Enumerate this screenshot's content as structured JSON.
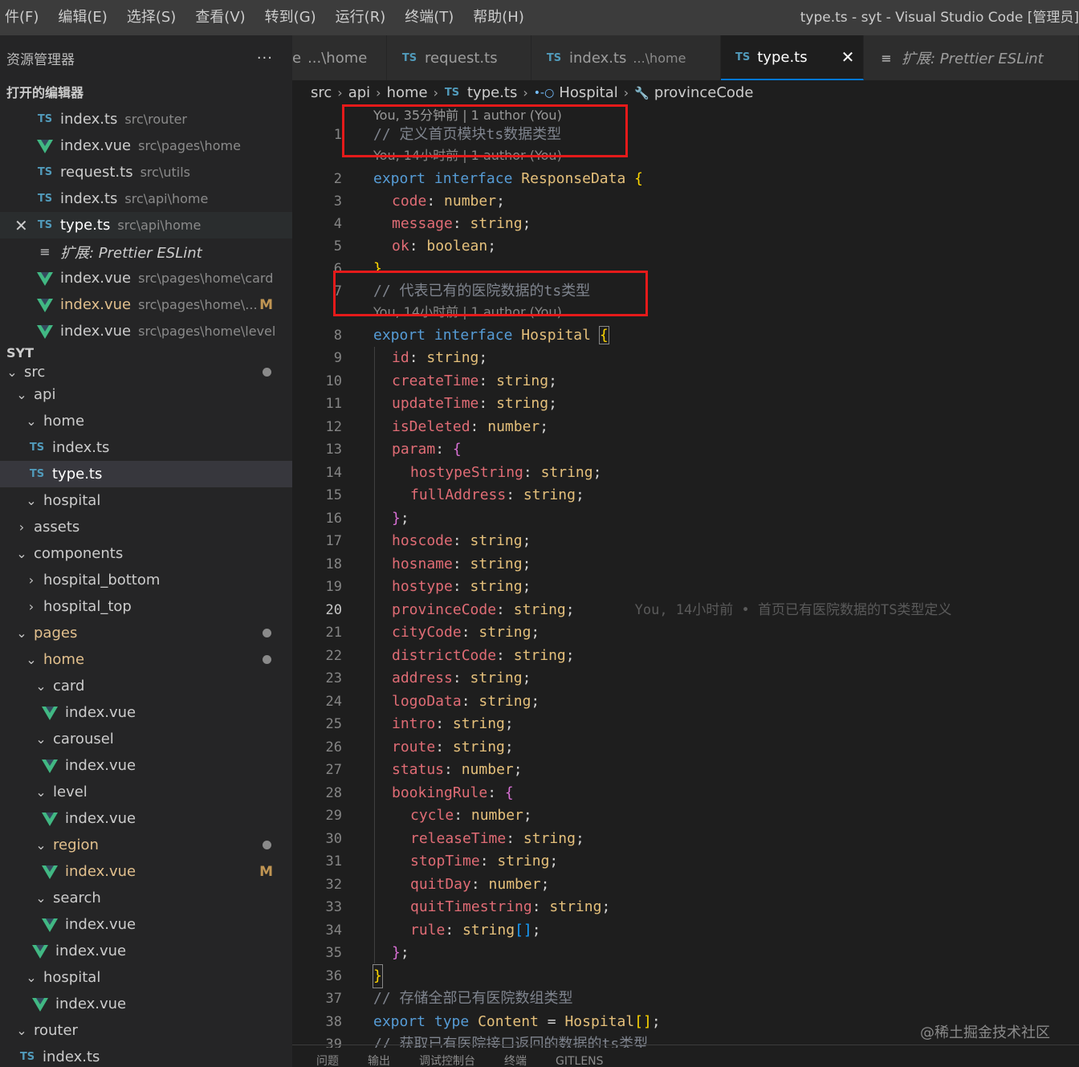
{
  "menu": [
    "件(F)",
    "编辑(E)",
    "选择(S)",
    "查看(V)",
    "转到(G)",
    "运行(R)",
    "终端(T)",
    "帮助(H)"
  ],
  "window_title": "type.ts - syt - Visual Studio Code [管理员]",
  "sidebar": {
    "title": "资源管理器",
    "more": "···",
    "open_editors_title": "打开的编辑器",
    "open_editors": [
      {
        "icon": "ts",
        "name": "index.ts",
        "desc": "src\\router"
      },
      {
        "icon": "vue",
        "name": "index.vue",
        "desc": "src\\pages\\home"
      },
      {
        "icon": "ts",
        "name": "request.ts",
        "desc": "src\\utils"
      },
      {
        "icon": "ts",
        "name": "index.ts",
        "desc": "src\\api\\home"
      },
      {
        "icon": "ts",
        "name": "type.ts",
        "desc": "src\\api\\home"
      },
      {
        "icon": "ext",
        "name": "扩展: Prettier ESLint",
        "desc": ""
      },
      {
        "icon": "vue",
        "name": "index.vue",
        "desc": "src\\pages\\home\\card"
      },
      {
        "icon": "vue",
        "name": "index.vue",
        "desc": "src\\pages\\home\\...",
        "badge": "M"
      },
      {
        "icon": "vue",
        "name": "index.vue",
        "desc": "src\\pages\\home\\level"
      }
    ],
    "project_title": "SYT",
    "tree": [
      {
        "name": "src",
        "chev": "v"
      },
      {
        "name": "api",
        "chev": "v"
      },
      {
        "name": "home",
        "chev": "v"
      },
      {
        "name": "index.ts",
        "icon": "ts"
      },
      {
        "name": "type.ts",
        "icon": "ts"
      },
      {
        "name": "hospital",
        "chev": "v"
      },
      {
        "name": "assets",
        "chev": ">"
      },
      {
        "name": "components",
        "chev": "v"
      },
      {
        "name": "hospital_bottom",
        "chev": ">"
      },
      {
        "name": "hospital_top",
        "chev": ">"
      },
      {
        "name": "pages",
        "chev": "v"
      },
      {
        "name": "home",
        "chev": "v"
      },
      {
        "name": "card",
        "chev": "v"
      },
      {
        "name": "index.vue",
        "icon": "vue"
      },
      {
        "name": "carousel",
        "chev": "v"
      },
      {
        "name": "index.vue",
        "icon": "vue"
      },
      {
        "name": "level",
        "chev": "v"
      },
      {
        "name": "index.vue",
        "icon": "vue"
      },
      {
        "name": "region",
        "chev": "v"
      },
      {
        "name": "index.vue",
        "icon": "vue",
        "badge": "M"
      },
      {
        "name": "search",
        "chev": "v"
      },
      {
        "name": "index.vue",
        "icon": "vue"
      },
      {
        "name": "index.vue",
        "icon": "vue"
      },
      {
        "name": "hospital",
        "chev": "v"
      },
      {
        "name": "index.vue",
        "icon": "vue"
      },
      {
        "name": "router",
        "chev": "v"
      },
      {
        "name": "index.ts",
        "icon": "ts"
      }
    ]
  },
  "tabs": [
    {
      "name": "...\\home",
      "prefix": "e"
    },
    {
      "icon": "TS",
      "name": "request.ts"
    },
    {
      "icon": "TS",
      "name": "index.ts",
      "desc": "...\\home"
    },
    {
      "icon": "TS",
      "name": "type.ts",
      "close": "✕"
    },
    {
      "icon": "≡",
      "name": "扩展: Prettier ESLint"
    }
  ],
  "breadcrumb": [
    "src",
    "api",
    "home",
    "type.ts",
    "Hospital",
    "provinceCode"
  ],
  "breadcrumb_icons": {
    "ts": "TS",
    "iface": "•-○",
    "prop": "🔧"
  },
  "codelens": {
    "first": "You, 35分钟前 | 1 author (You)",
    "second": "You, 14小时前 | 1 author (You)",
    "third": "You, 14小时前 | 1 author (You)"
  },
  "blame_line20": "You, 14小时前 • 首页已有医院数据的TS类型定义",
  "watermark": "@稀土掘金技术社区",
  "panel_tabs": [
    "问题",
    "输出",
    "调试控制台",
    "终端",
    "GITLENS"
  ],
  "code": [
    {
      "n": "1",
      "t": "// 定义首页模块ts数据类型"
    },
    {
      "n": "2",
      "t": "export interface ResponseData {"
    },
    {
      "n": "3",
      "t": "code: number;"
    },
    {
      "n": "4",
      "t": "message: string;"
    },
    {
      "n": "5",
      "t": "ok: boolean;"
    },
    {
      "n": "6",
      "t": "}"
    },
    {
      "n": "7",
      "t": "// 代表已有的医院数据的ts类型"
    },
    {
      "n": "8",
      "t": "export interface Hospital {"
    },
    {
      "n": "9",
      "t": "id: string;"
    },
    {
      "n": "10",
      "t": "createTime: string;"
    },
    {
      "n": "11",
      "t": "updateTime: string;"
    },
    {
      "n": "12",
      "t": "isDeleted: number;"
    },
    {
      "n": "13",
      "t": "param: {"
    },
    {
      "n": "14",
      "t": "hostypeString: string;"
    },
    {
      "n": "15",
      "t": "fullAddress: string;"
    },
    {
      "n": "16",
      "t": "};"
    },
    {
      "n": "17",
      "t": "hoscode: string;"
    },
    {
      "n": "18",
      "t": "hosname: string;"
    },
    {
      "n": "19",
      "t": "hostype: string;"
    },
    {
      "n": "20",
      "t": "provinceCode: string;"
    },
    {
      "n": "21",
      "t": "cityCode: string;"
    },
    {
      "n": "22",
      "t": "districtCode: string;"
    },
    {
      "n": "23",
      "t": "address: string;"
    },
    {
      "n": "24",
      "t": "logoData: string;"
    },
    {
      "n": "25",
      "t": "intro: string;"
    },
    {
      "n": "26",
      "t": "route: string;"
    },
    {
      "n": "27",
      "t": "status: number;"
    },
    {
      "n": "28",
      "t": "bookingRule: {"
    },
    {
      "n": "29",
      "t": "cycle: number;"
    },
    {
      "n": "30",
      "t": "releaseTime: string;"
    },
    {
      "n": "31",
      "t": "stopTime: string;"
    },
    {
      "n": "32",
      "t": "quitDay: number;"
    },
    {
      "n": "33",
      "t": "quitTimestring: string;"
    },
    {
      "n": "34",
      "t": "rule: string[];"
    },
    {
      "n": "35",
      "t": "};"
    },
    {
      "n": "36",
      "t": "}"
    },
    {
      "n": "37",
      "t": "// 存储全部已有医院数组类型"
    },
    {
      "n": "38",
      "t": "export type Content = Hospital[];"
    },
    {
      "n": "39",
      "t": "// 获取已有医院接口返回的数据的ts类型"
    }
  ]
}
